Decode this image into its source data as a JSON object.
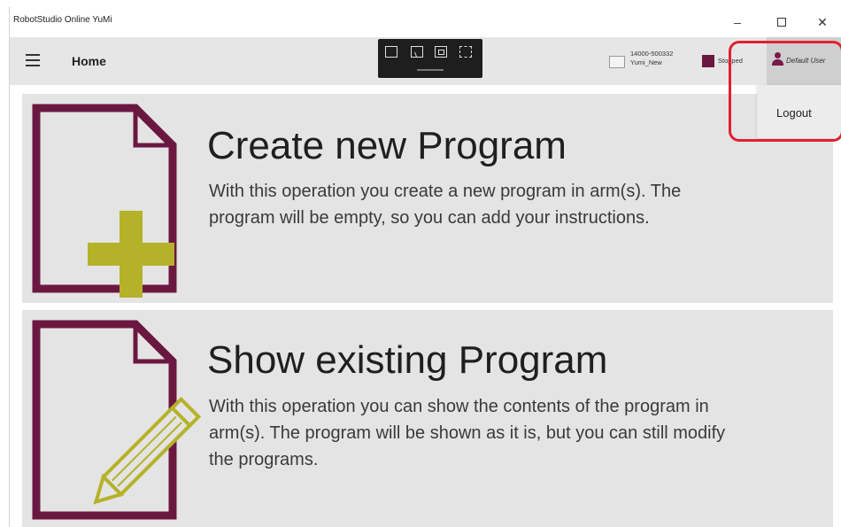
{
  "window": {
    "title": "RobotStudio Online YuMi",
    "controls": {
      "minimize": "–",
      "close": "✕"
    }
  },
  "header": {
    "title": "Home",
    "toolbar_icons": [
      "document-arrow-icon",
      "pointer-screen-icon",
      "frame-icon",
      "dashed-select-icon"
    ],
    "controller": {
      "id": "14000-500332",
      "name": "Yumi_New"
    },
    "status": {
      "label": "Stopped",
      "color": "#6b1840"
    },
    "user": {
      "name": "Default User"
    }
  },
  "user_menu": {
    "logout_label": "Logout"
  },
  "cards": {
    "create": {
      "title": "Create new Program",
      "description": "With this operation you create a new program in arm(s). The program will be empty, so you can add your instructions."
    },
    "show": {
      "title": "Show existing Program",
      "description": "With this operation you can show the contents of the program in arm(s). The program will be shown as it is, but you can still modify the programs."
    }
  },
  "colors": {
    "accent": "#6b1840",
    "icon_accent": "#b5b229",
    "highlight": "#e0202f",
    "card_bg": "#e4e4e4"
  }
}
